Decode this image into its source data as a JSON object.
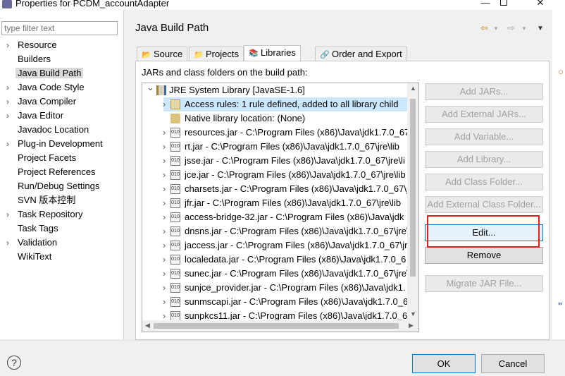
{
  "window": {
    "title": "Properties for PCDM_accountAdapter",
    "controls": {
      "minimize": "—",
      "close": "✕"
    }
  },
  "filter": {
    "placeholder": "type filter text"
  },
  "nav": {
    "items": [
      {
        "label": "Resource",
        "expandable": true
      },
      {
        "label": "Builders",
        "expandable": false
      },
      {
        "label": "Java Build Path",
        "expandable": false,
        "selected": true
      },
      {
        "label": "Java Code Style",
        "expandable": true
      },
      {
        "label": "Java Compiler",
        "expandable": true
      },
      {
        "label": "Java Editor",
        "expandable": true
      },
      {
        "label": "Javadoc Location",
        "expandable": false
      },
      {
        "label": "Plug-in Development",
        "expandable": true
      },
      {
        "label": "Project Facets",
        "expandable": false
      },
      {
        "label": "Project References",
        "expandable": false
      },
      {
        "label": "Run/Debug Settings",
        "expandable": false
      },
      {
        "label": "SVN 版本控制",
        "expandable": false
      },
      {
        "label": "Task Repository",
        "expandable": true
      },
      {
        "label": "Task Tags",
        "expandable": false
      },
      {
        "label": "Validation",
        "expandable": true
      },
      {
        "label": "WikiText",
        "expandable": false
      }
    ]
  },
  "header": {
    "title": "Java Build Path",
    "back": "⇦",
    "forward": "⇨",
    "menu": "▼"
  },
  "tabs": [
    {
      "label": "Source",
      "icon": "source-folder-icon",
      "glyph": "📂"
    },
    {
      "label": "Projects",
      "icon": "projects-icon",
      "glyph": "📁"
    },
    {
      "label": "Libraries",
      "icon": "libraries-icon",
      "glyph": "📚",
      "active": true
    },
    {
      "label": "Order and Export",
      "icon": "order-export-icon",
      "glyph": "🔗"
    }
  ],
  "panel": {
    "caption": "JARs and class folders on the build path:"
  },
  "tree": {
    "root": "JRE System Library [JavaSE-1.6]",
    "children": [
      {
        "label": "Access rules: 1 rule defined, added to all library child",
        "icon": "access-rules-icon",
        "selected": true,
        "twisty": true
      },
      {
        "label": "Native library location: (None)",
        "icon": "native-library-icon",
        "twisty": false
      },
      {
        "label": "resources.jar - C:\\Program Files (x86)\\Java\\jdk1.7.0_67",
        "icon": "jar-icon",
        "twisty": true
      },
      {
        "label": "rt.jar - C:\\Program Files (x86)\\Java\\jdk1.7.0_67\\jre\\lib",
        "icon": "jar-icon",
        "twisty": true
      },
      {
        "label": "jsse.jar - C:\\Program Files (x86)\\Java\\jdk1.7.0_67\\jre\\li",
        "icon": "jar-icon",
        "twisty": true
      },
      {
        "label": "jce.jar - C:\\Program Files (x86)\\Java\\jdk1.7.0_67\\jre\\lib",
        "icon": "jar-icon",
        "twisty": true
      },
      {
        "label": "charsets.jar - C:\\Program Files (x86)\\Java\\jdk1.7.0_67\\jr",
        "icon": "jar-icon",
        "twisty": true
      },
      {
        "label": "jfr.jar - C:\\Program Files (x86)\\Java\\jdk1.7.0_67\\jre\\lib",
        "icon": "jar-icon",
        "twisty": true
      },
      {
        "label": "access-bridge-32.jar - C:\\Program Files (x86)\\Java\\jdk",
        "icon": "jar-icon",
        "twisty": true
      },
      {
        "label": "dnsns.jar - C:\\Program Files (x86)\\Java\\jdk1.7.0_67\\jre\\",
        "icon": "jar-icon",
        "twisty": true
      },
      {
        "label": "jaccess.jar - C:\\Program Files (x86)\\Java\\jdk1.7.0_67\\jr",
        "icon": "jar-icon",
        "twisty": true
      },
      {
        "label": "localedata.jar - C:\\Program Files (x86)\\Java\\jdk1.7.0_6",
        "icon": "jar-icon",
        "twisty": true
      },
      {
        "label": "sunec.jar - C:\\Program Files (x86)\\Java\\jdk1.7.0_67\\jre\\",
        "icon": "jar-icon",
        "twisty": true
      },
      {
        "label": "sunjce_provider.jar - C:\\Program Files (x86)\\Java\\jdk1.",
        "icon": "jar-icon",
        "twisty": true
      },
      {
        "label": "sunmscapi.jar - C:\\Program Files (x86)\\Java\\jdk1.7.0_6",
        "icon": "jar-icon",
        "twisty": true
      },
      {
        "label": "sunpkcs11.jar - C:\\Program Files (x86)\\Java\\jdk1.7.0_6",
        "icon": "jar-icon",
        "twisty": true
      }
    ]
  },
  "buttons": [
    {
      "label": "Add JARs...",
      "enabled": false
    },
    {
      "label": "Add External JARs...",
      "enabled": false
    },
    {
      "label": "Add Variable...",
      "enabled": false
    },
    {
      "label": "Add Library...",
      "enabled": false
    },
    {
      "label": "Add Class Folder...",
      "enabled": false
    },
    {
      "label": "Add External Class Folder...",
      "enabled": false
    },
    {
      "label": "Edit...",
      "enabled": true,
      "focused": true
    },
    {
      "label": "Remove",
      "enabled": true
    },
    {
      "label": "Migrate JAR File...",
      "enabled": false
    }
  ],
  "footer": {
    "help": "?",
    "ok": "OK",
    "cancel": "Cancel"
  },
  "colors": {
    "selection": "#cce8ff",
    "highlight": "#e51d1d",
    "focus": "#0078d7"
  }
}
